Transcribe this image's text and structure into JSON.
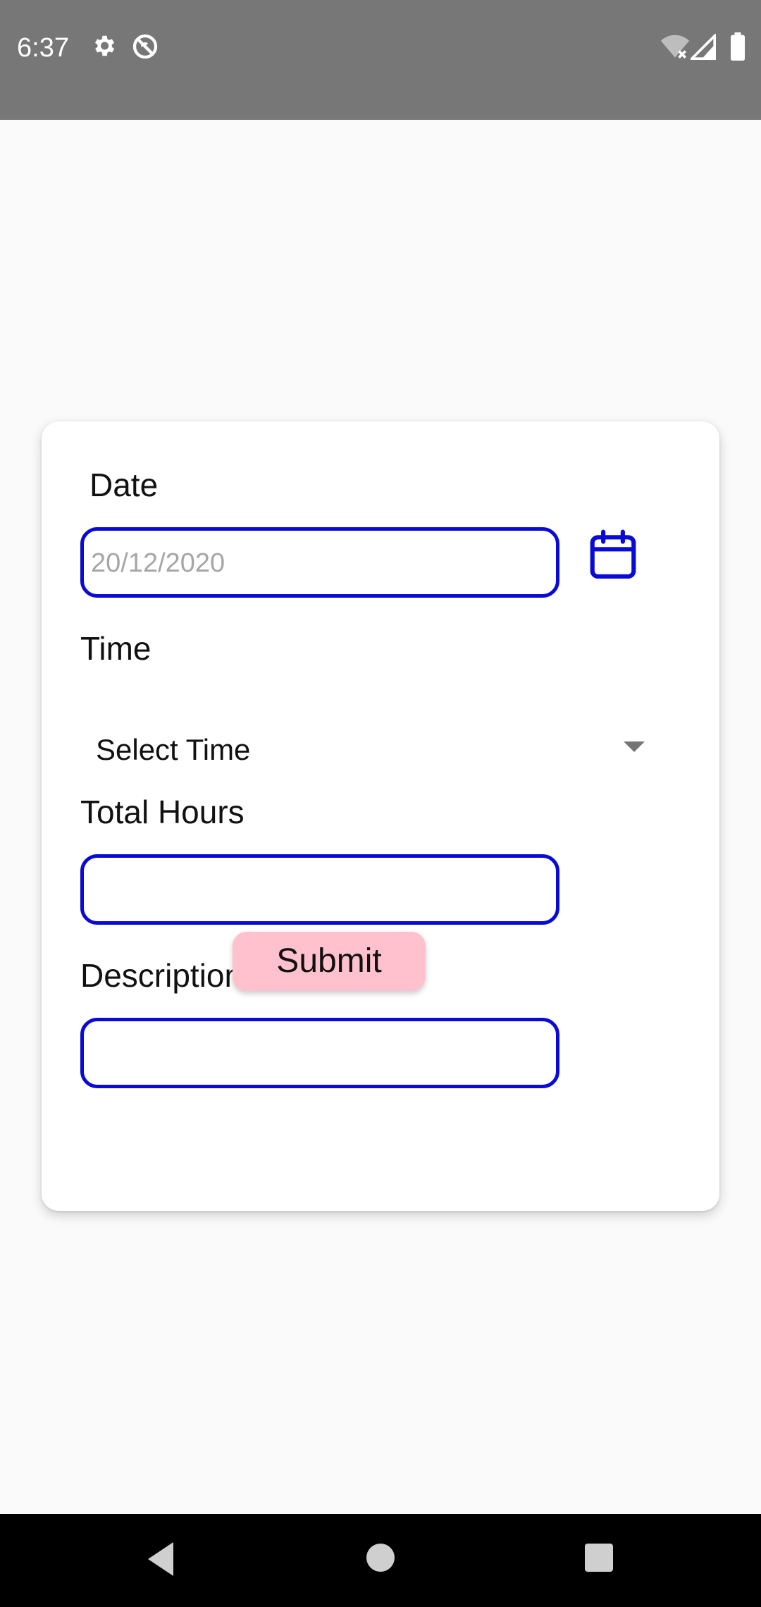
{
  "status_bar": {
    "time": "6:37",
    "icons": [
      "gear-icon",
      "do-not-disturb-icon",
      "wifi-off-icon",
      "signal-icon",
      "battery-icon"
    ]
  },
  "form": {
    "date_label": "Date",
    "date_value": "20/12/2020",
    "time_label": "Time",
    "time_select": "Select Time",
    "total_hours_label": "Total Hours",
    "total_hours_value": "",
    "description_label": "Description",
    "description_value": "",
    "submit_label": "Submit"
  },
  "colors": {
    "field_border": "#0a0ad6",
    "submit_bg": "#ffc1cd",
    "status_bar_bg": "#777777",
    "nav_bar_bg": "#000000"
  },
  "nav_bar": {
    "icons": [
      "back-icon",
      "home-icon",
      "recents-icon"
    ]
  }
}
